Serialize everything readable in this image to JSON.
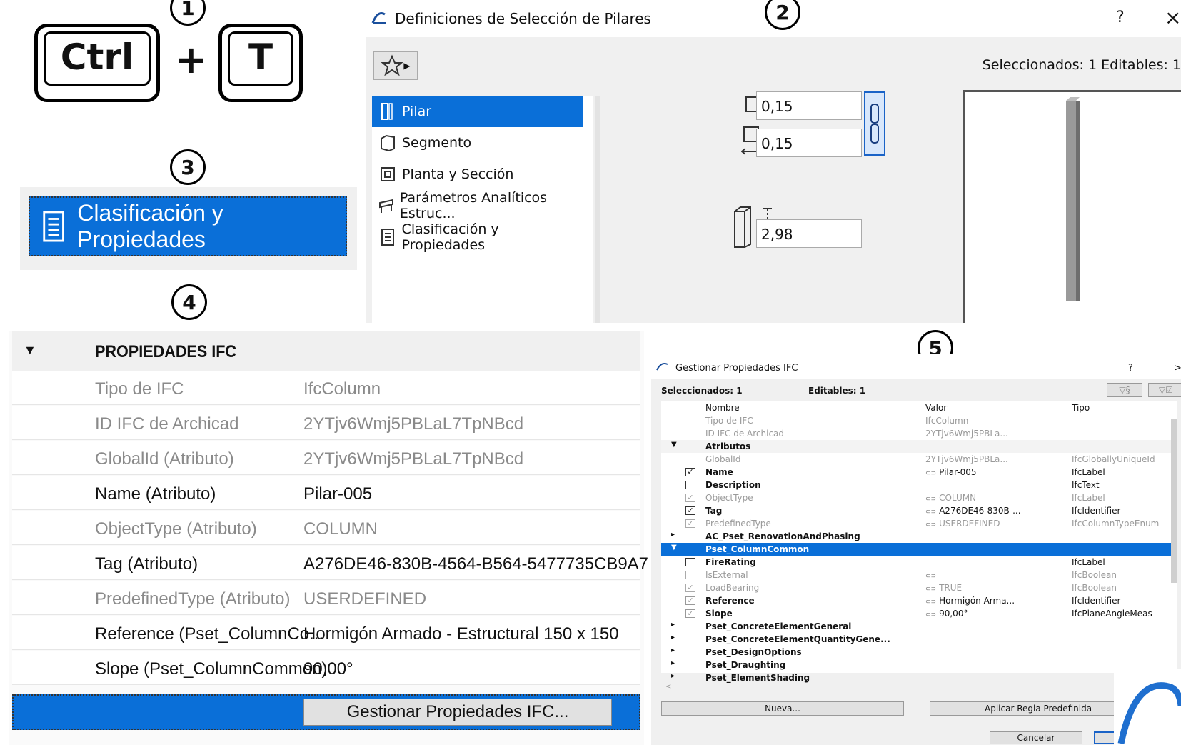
{
  "steps": {
    "s1": "1",
    "s2": "2",
    "s3": "3",
    "s4": "4",
    "s5": "5"
  },
  "shortcut": {
    "key1": "Ctrl",
    "plus": "+",
    "key2": "T"
  },
  "classif_button": {
    "label": "Clasificación y Propiedades",
    "icon": "document-list-icon"
  },
  "dialog": {
    "title": "Definiciones de Selección de Pilares",
    "help": "?",
    "close": "×",
    "selection_info": "Seleccionados: 1 Editables: 1",
    "nav": [
      {
        "label": "Pilar",
        "icon": "column-icon"
      },
      {
        "label": "Segmento",
        "icon": "segment-icon"
      },
      {
        "label": "Planta y Sección",
        "icon": "floor-plan-icon"
      },
      {
        "label": "Parámetros Analíticos Estruc...",
        "icon": "structural-icon"
      },
      {
        "label": "Clasificación y Propiedades",
        "icon": "document-list-icon"
      }
    ],
    "width": "0,15",
    "depth": "0,15",
    "height": "2,98"
  },
  "props": {
    "section": "PROPIEDADES IFC",
    "rows": [
      {
        "k": "Tipo de IFC",
        "v": "IfcColumn"
      },
      {
        "k": "ID IFC de Archicad",
        "v": "2YTjv6Wmj5PBLaL7TpNBcd"
      },
      {
        "k": "GlobalId (Atributo)",
        "v": "2YTjv6Wmj5PBLaL7TpNBcd"
      },
      {
        "k": "Name (Atributo)",
        "v": "Pilar-005"
      },
      {
        "k": "ObjectType (Atributo)",
        "v": "COLUMN"
      },
      {
        "k": "Tag (Atributo)",
        "v": "A276DE46-830B-4564-B564-5477735CB9A7"
      },
      {
        "k": "PredefinedType (Atributo)",
        "v": "USERDEFINED"
      },
      {
        "k": "Reference (Pset_ColumnCo...",
        "v": "Hormigón Armado - Estructural 150 x 150"
      },
      {
        "k": "Slope (Pset_ColumnCommon)",
        "v": "90,00°"
      }
    ],
    "manage_button": "Gestionar Propiedades IFC..."
  },
  "ifc": {
    "title": "Gestionar Propiedades IFC",
    "help": "?",
    "close": ">",
    "selected": "Seleccionados: 1",
    "editable": "Editables: 1",
    "cols": {
      "name": "Nombre",
      "value": "Valor",
      "type": "Tipo"
    },
    "r0": {
      "nm": "Tipo de IFC",
      "vl": "IfcColumn"
    },
    "r1": {
      "nm": "ID IFC de Archicad",
      "vl": "2YTjv6Wmj5PBLa..."
    },
    "r2": {
      "nm": "Atributos"
    },
    "r3": {
      "nm": "GlobalId",
      "vl": "2YTjv6Wmj5PBLa...",
      "tp": "IfcGloballyUniqueId"
    },
    "r4": {
      "nm": "Name",
      "vl": "Pilar-005",
      "tp": "IfcLabel"
    },
    "r5": {
      "nm": "Description",
      "tp": "IfcText"
    },
    "r6": {
      "nm": "ObjectType",
      "vl": "COLUMN",
      "tp": "IfcLabel"
    },
    "r7": {
      "nm": "Tag",
      "vl": "A276DE46-830B-...",
      "tp": "IfcIdentifier"
    },
    "r8": {
      "nm": "PredefinedType",
      "vl": "USERDEFINED",
      "tp": "IfcColumnTypeEnum"
    },
    "r9": {
      "nm": "AC_Pset_RenovationAndPhasing"
    },
    "r10": {
      "nm": "Pset_ColumnCommon"
    },
    "r11": {
      "nm": "FireRating",
      "tp": "IfcLabel"
    },
    "r12": {
      "nm": "IsExternal",
      "tp": "IfcBoolean"
    },
    "r13": {
      "nm": "LoadBearing",
      "vl": "TRUE",
      "tp": "IfcBoolean"
    },
    "r14": {
      "nm": "Reference",
      "vl": "Hormigón Arma...",
      "tp": "IfcIdentifier"
    },
    "r15": {
      "nm": "Slope",
      "vl": "90,00°",
      "tp": "IfcPlaneAngleMeas"
    },
    "r16": {
      "nm": "Pset_ConcreteElementGeneral"
    },
    "r17": {
      "nm": "Pset_ConcreteElementQuantityGene..."
    },
    "r18": {
      "nm": "Pset_DesignOptions"
    },
    "r19": {
      "nm": "Pset_Draughting"
    },
    "r20": {
      "nm": "Pset_ElementShading"
    },
    "new_button": "Nueva...",
    "apply_button": "Aplicar Regla Predefinida",
    "cancel_button": "Cancelar"
  }
}
